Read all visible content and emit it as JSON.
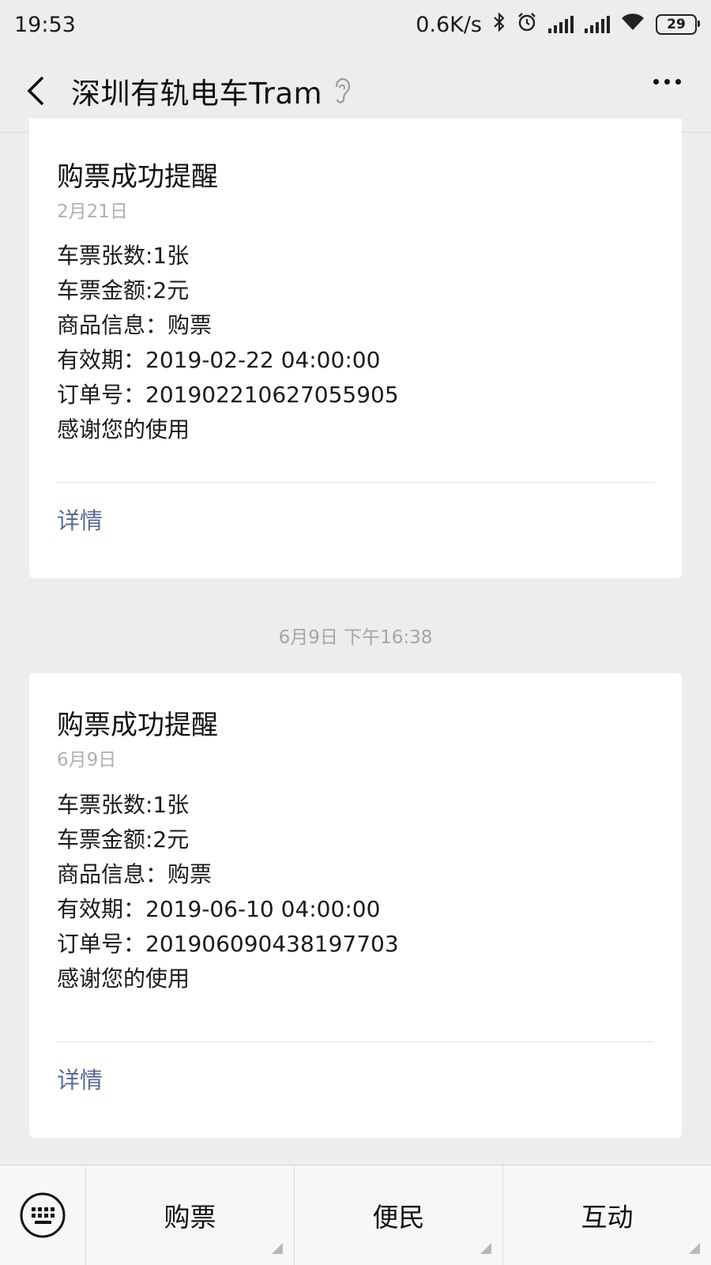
{
  "status": {
    "time": "19:53",
    "network_speed": "0.6K/s",
    "battery": "29"
  },
  "header": {
    "title": "深圳有轨电车Tram"
  },
  "messages": [
    {
      "title": "购票成功提醒",
      "date": "2月21日",
      "lines": [
        "车票张数:1张",
        "车票金额:2元",
        "商品信息：购票",
        "有效期：2019-02-22 04:00:00",
        "订单号：201902210627055905",
        "感谢您的使用"
      ],
      "detail_label": "详情"
    },
    {
      "title": "购票成功提醒",
      "date": "6月9日",
      "lines": [
        "车票张数:1张",
        "车票金额:2元",
        "商品信息：购票",
        "有效期：2019-06-10 04:00:00",
        "订单号：201906090438197703",
        "感谢您的使用"
      ],
      "detail_label": "详情"
    }
  ],
  "timestamp": "6月9日 下午16:38",
  "menu": {
    "items": [
      "购票",
      "便民",
      "互动"
    ]
  }
}
